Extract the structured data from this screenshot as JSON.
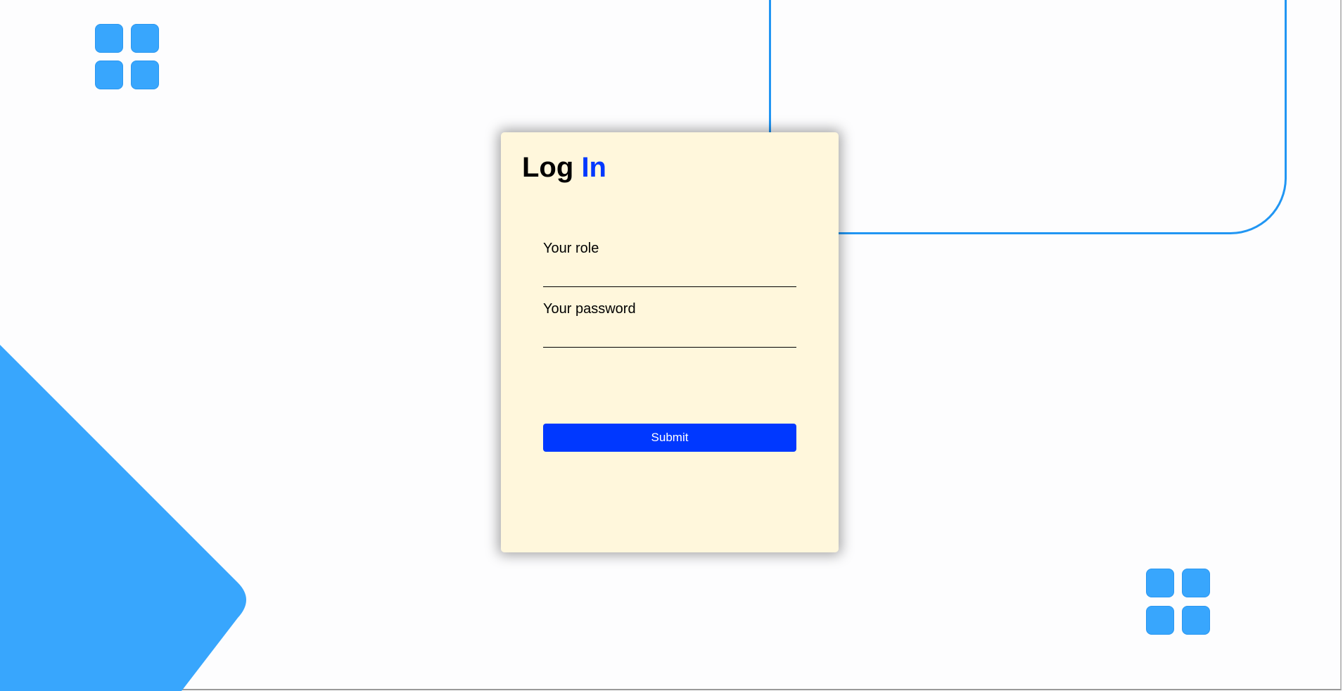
{
  "login": {
    "title_part1": "Log",
    "title_part2": "In",
    "role_label": "Your role",
    "role_value": "",
    "password_label": "Your password",
    "password_value": "",
    "submit_label": "Submit"
  },
  "colors": {
    "accent": "#0038ff",
    "decor": "#38a6fd",
    "card": "#fff7dc"
  }
}
